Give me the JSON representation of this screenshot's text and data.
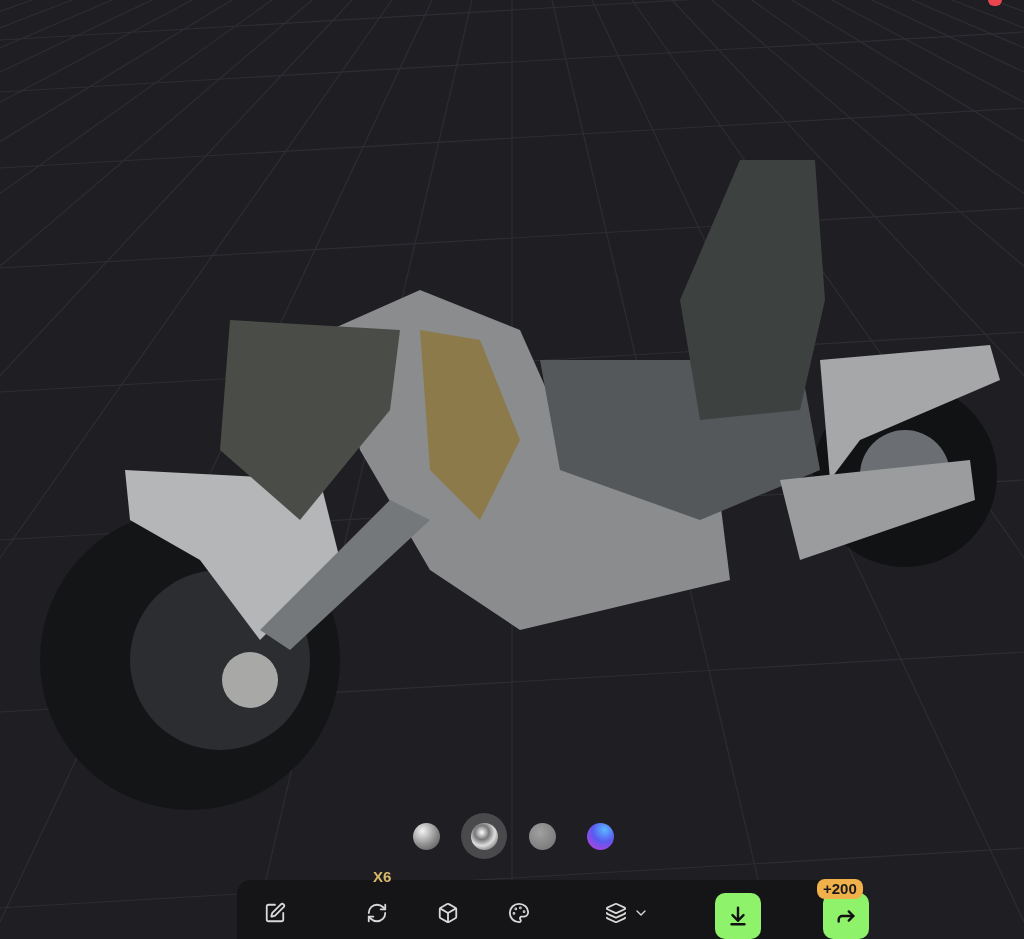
{
  "materials": [
    {
      "kind": "matte",
      "selected": false
    },
    {
      "kind": "chrome",
      "selected": true
    },
    {
      "kind": "flat",
      "selected": false
    },
    {
      "kind": "gradient",
      "selected": false
    }
  ],
  "toolbar": [
    {
      "kind": "edit"
    },
    {
      "kind": "divider"
    },
    {
      "kind": "remesh",
      "badge": "X6"
    },
    {
      "kind": "cube"
    },
    {
      "kind": "texture"
    },
    {
      "kind": "divider"
    },
    {
      "kind": "model-menu"
    },
    {
      "kind": "divider"
    },
    {
      "kind": "download"
    },
    {
      "kind": "divider"
    },
    {
      "kind": "share",
      "badge": "+200"
    }
  ]
}
